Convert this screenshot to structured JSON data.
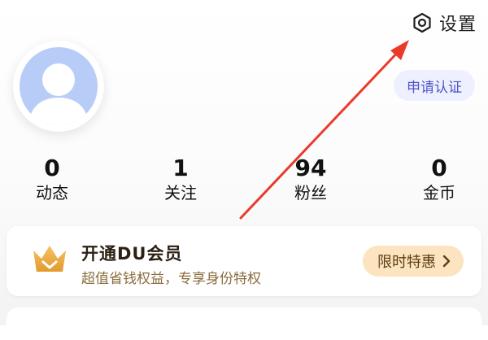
{
  "header": {
    "settings_label": "设置"
  },
  "profile": {
    "verify_label": "申请认证"
  },
  "stats": [
    {
      "value": "0",
      "label": "动态"
    },
    {
      "value": "1",
      "label": "关注"
    },
    {
      "value": "94",
      "label": "粉丝"
    },
    {
      "value": "0",
      "label": "金币"
    }
  ],
  "vip": {
    "title": "开通DU会员",
    "subtitle": "超值省钱权益，专享身份特权",
    "cta_label": "限时特惠"
  },
  "colors": {
    "verify_bg": "#eef0ff",
    "verify_text": "#4e55c8",
    "annotation_arrow": "#ea3a2a",
    "vip_gold": "#f0a63a"
  }
}
